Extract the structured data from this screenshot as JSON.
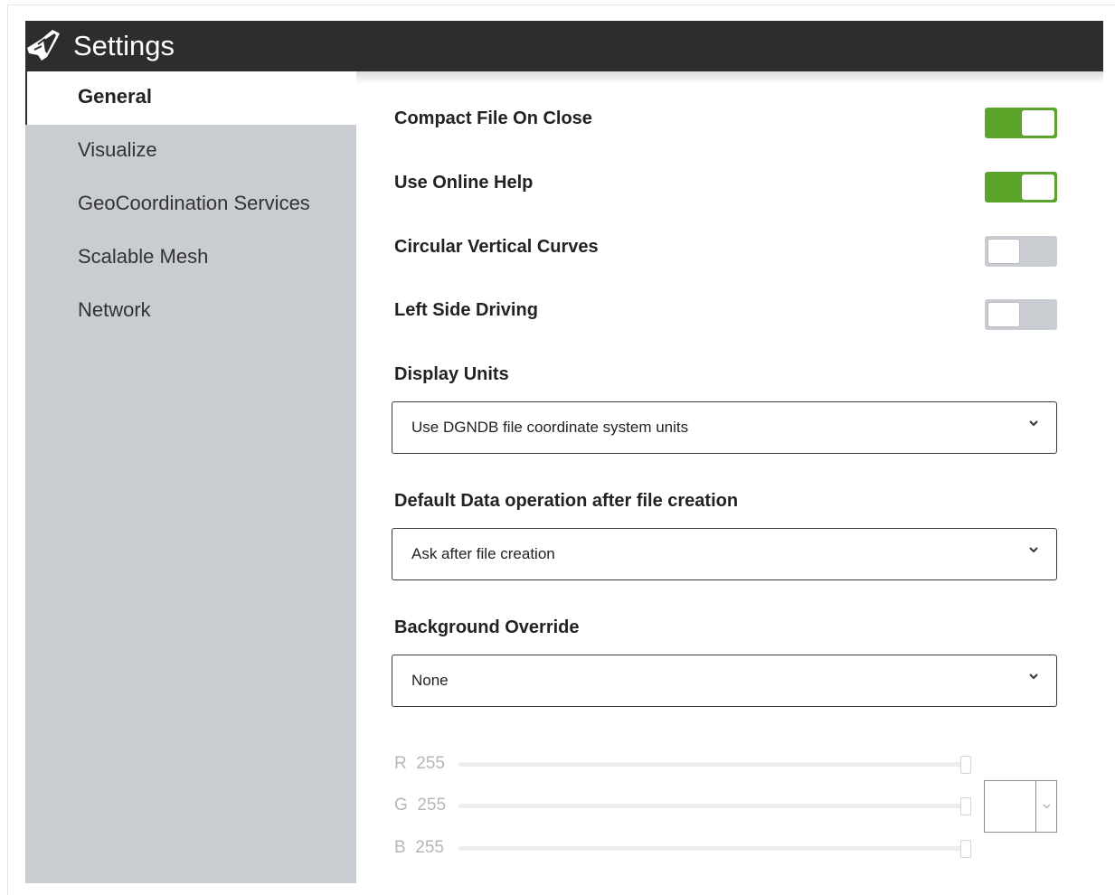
{
  "window": {
    "title": "Settings"
  },
  "sidebar": {
    "items": [
      {
        "label": "General",
        "active": true
      },
      {
        "label": "Visualize",
        "active": false
      },
      {
        "label": "GeoCoordination Services",
        "active": false
      },
      {
        "label": "Scalable Mesh",
        "active": false
      },
      {
        "label": "Network",
        "active": false
      }
    ]
  },
  "settings": {
    "toggles": [
      {
        "label": "Compact File On Close",
        "on": true
      },
      {
        "label": "Use Online Help",
        "on": true
      },
      {
        "label": "Circular Vertical Curves",
        "on": false
      },
      {
        "label": "Left Side Driving",
        "on": false
      }
    ],
    "display_units": {
      "label": "Display Units",
      "value": "Use DGNDB file coordinate system units"
    },
    "default_data_operation": {
      "label": "Default Data operation after file creation",
      "value": "Ask after file creation"
    },
    "background_override": {
      "label": "Background Override",
      "value": "None"
    },
    "color": {
      "r_label": "R",
      "r_value": "255",
      "g_label": "G",
      "g_value": "255",
      "b_label": "B",
      "b_value": "255"
    }
  },
  "colors": {
    "accent_on": "#5ba42a",
    "titlebar": "#2b2d2f",
    "sidebar": "#c9ccd0"
  },
  "icons": {
    "app": "road-logo-icon",
    "dropdown": "chevron-down-icon"
  }
}
